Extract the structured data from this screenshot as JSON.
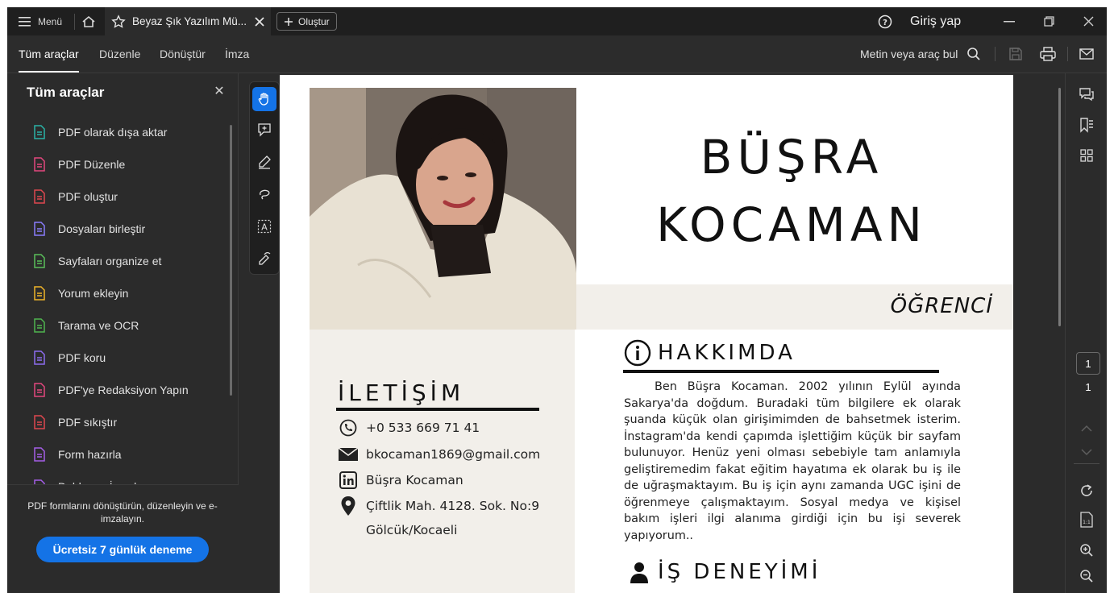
{
  "titlebar": {
    "menu_label": "Menü",
    "tab_title": "Beyaz Şık Yazılım Mü...",
    "new_label": "Oluştur",
    "login_label": "Giriş yap"
  },
  "menubar": {
    "tabs": [
      {
        "label": "Tüm araçlar",
        "active": true
      },
      {
        "label": "Düzenle",
        "active": false
      },
      {
        "label": "Dönüştür",
        "active": false
      },
      {
        "label": "İmza",
        "active": false
      }
    ],
    "search_label": "Metin veya araç bul"
  },
  "left_panel": {
    "title": "Tüm araçlar",
    "tools": [
      {
        "label": "PDF olarak dışa aktar",
        "icon": "export-pdf-icon",
        "color": "#2bb3a7"
      },
      {
        "label": "PDF Düzenle",
        "icon": "edit-pdf-icon",
        "color": "#e3477e"
      },
      {
        "label": "PDF oluştur",
        "icon": "create-pdf-icon",
        "color": "#e0484f"
      },
      {
        "label": "Dosyaları birleştir",
        "icon": "combine-files-icon",
        "color": "#8a7dfc"
      },
      {
        "label": "Sayfaları organize et",
        "icon": "organize-pages-icon",
        "color": "#5bbf5b"
      },
      {
        "label": "Yorum ekleyin",
        "icon": "comment-icon",
        "color": "#f0b429"
      },
      {
        "label": "Tarama ve OCR",
        "icon": "scan-ocr-icon",
        "color": "#4fb54f"
      },
      {
        "label": "PDF koru",
        "icon": "protect-pdf-icon",
        "color": "#8d6cf0"
      },
      {
        "label": "PDF'ye Redaksiyon Yapın",
        "icon": "redact-icon",
        "color": "#e3477e"
      },
      {
        "label": "PDF sıkıştır",
        "icon": "compress-pdf-icon",
        "color": "#e0484f"
      },
      {
        "label": "Form hazırla",
        "icon": "prepare-form-icon",
        "color": "#a55ee8"
      },
      {
        "label": "Doldur ve İmzala",
        "icon": "fill-sign-icon",
        "color": "#a55ee8"
      }
    ],
    "promo_text": "PDF formlarını dönüştürün, düzenleyin ve e-imzalayın.",
    "trial_button": "Ücretsiz 7 günlük deneme"
  },
  "document": {
    "name_first": "BÜŞRA",
    "name_last": "KOCAMAN",
    "role": "ÖĞRENCİ",
    "contact_heading": "İLETİŞİM",
    "phone": "+0 533 669 71 41",
    "email": "bkocaman1869@gmail.com",
    "linkedin": "Büşra Kocaman",
    "address_line1": "Çiftlik Mah. 4128. Sok. No:9",
    "address_line2": "Gölcük/Kocaeli",
    "about_heading": "HAKKIMDA",
    "about_text": "Ben Büşra Kocaman. 2002 yılının Eylül ayında Sakarya'da doğdum. Buradaki tüm bilgilere ek olarak şuanda küçük olan girişimimden de bahsetmek isterim. İnstagram'da kendi çapımda işlettiğim küçük bir sayfam bulunuyor. Henüz yeni olması sebebiyle tam anlamıyla geliştiremedim fakat eğitim hayatıma ek olarak bu iş ile de uğraşmaktayım. Bu iş için aynı zamanda UGC işini de öğrenmeye çalışmaktayım. Sosyal medya ve kişisel bakım işleri ilgi alanıma girdiği için bu işi severek yapıyorum..",
    "experience_heading": "İŞ DENEYİMİ"
  },
  "right_rail": {
    "current_page": "1",
    "total_pages": "1"
  },
  "colors": {
    "accent": "#1473e6",
    "panel_bg": "#2b2b2b",
    "titlebar_bg": "#1f1f1f",
    "cv_band": "#f2efea"
  }
}
